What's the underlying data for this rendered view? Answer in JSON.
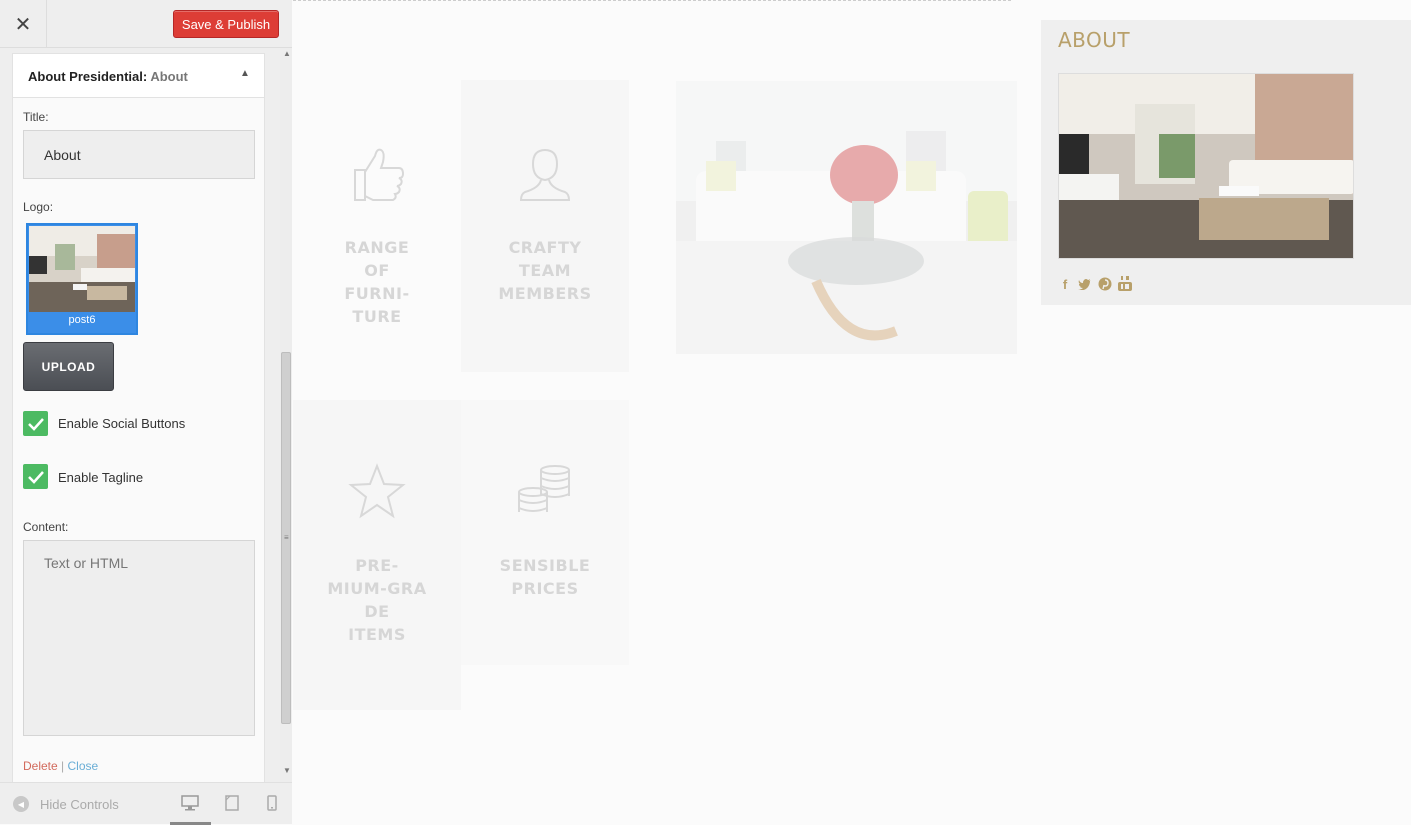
{
  "header": {
    "close_label": "✕",
    "publish_label": "Save & Publish"
  },
  "widget": {
    "title_prefix": "About Presidential:",
    "title_suffix": "About",
    "title_label": "Title:",
    "title_value": "About",
    "logo_label": "Logo:",
    "logo_caption": "post6",
    "upload_label": "UPLOAD",
    "social_label": "Enable Social Buttons",
    "social_checked": true,
    "tagline_label": "Enable Tagline",
    "tagline_checked": true,
    "content_label": "Content:",
    "content_placeholder": "Text or HTML",
    "delete_label": "Delete",
    "separator": "|",
    "close_label": "Close"
  },
  "footer": {
    "hide_controls_label": "Hide Controls"
  },
  "preview": {
    "services": [
      {
        "title": "RANGE OF FURNI-TURE",
        "lines": [
          "RANGE",
          "OF",
          "FURNI-",
          "TURE"
        ],
        "icon": "thumbs-up-icon"
      },
      {
        "title": "CRAFTY TEAM MEMBERS",
        "lines": [
          "CRAFTY",
          "TEAM",
          "MEMBERS"
        ],
        "icon": "user-icon"
      },
      {
        "title": "PRE-MIUM-GRADE ITEMS",
        "lines": [
          "PRE-",
          "MIUM-GRA",
          "DE",
          "ITEMS"
        ],
        "icon": "star-icon"
      },
      {
        "title": "SENSIBLE PRICES",
        "lines": [
          "SENSIBLE",
          "PRICES"
        ],
        "icon": "coins-icon"
      }
    ],
    "sidebar": {
      "title": "ABOUT",
      "social": [
        "facebook-icon",
        "twitter-icon",
        "pinterest-icon",
        "youtube-icon"
      ]
    }
  },
  "colors": {
    "publish": "#dd3d36",
    "checkbox": "#4cba62",
    "accent": "#b8a06a",
    "logo_border": "#2e86e0"
  }
}
